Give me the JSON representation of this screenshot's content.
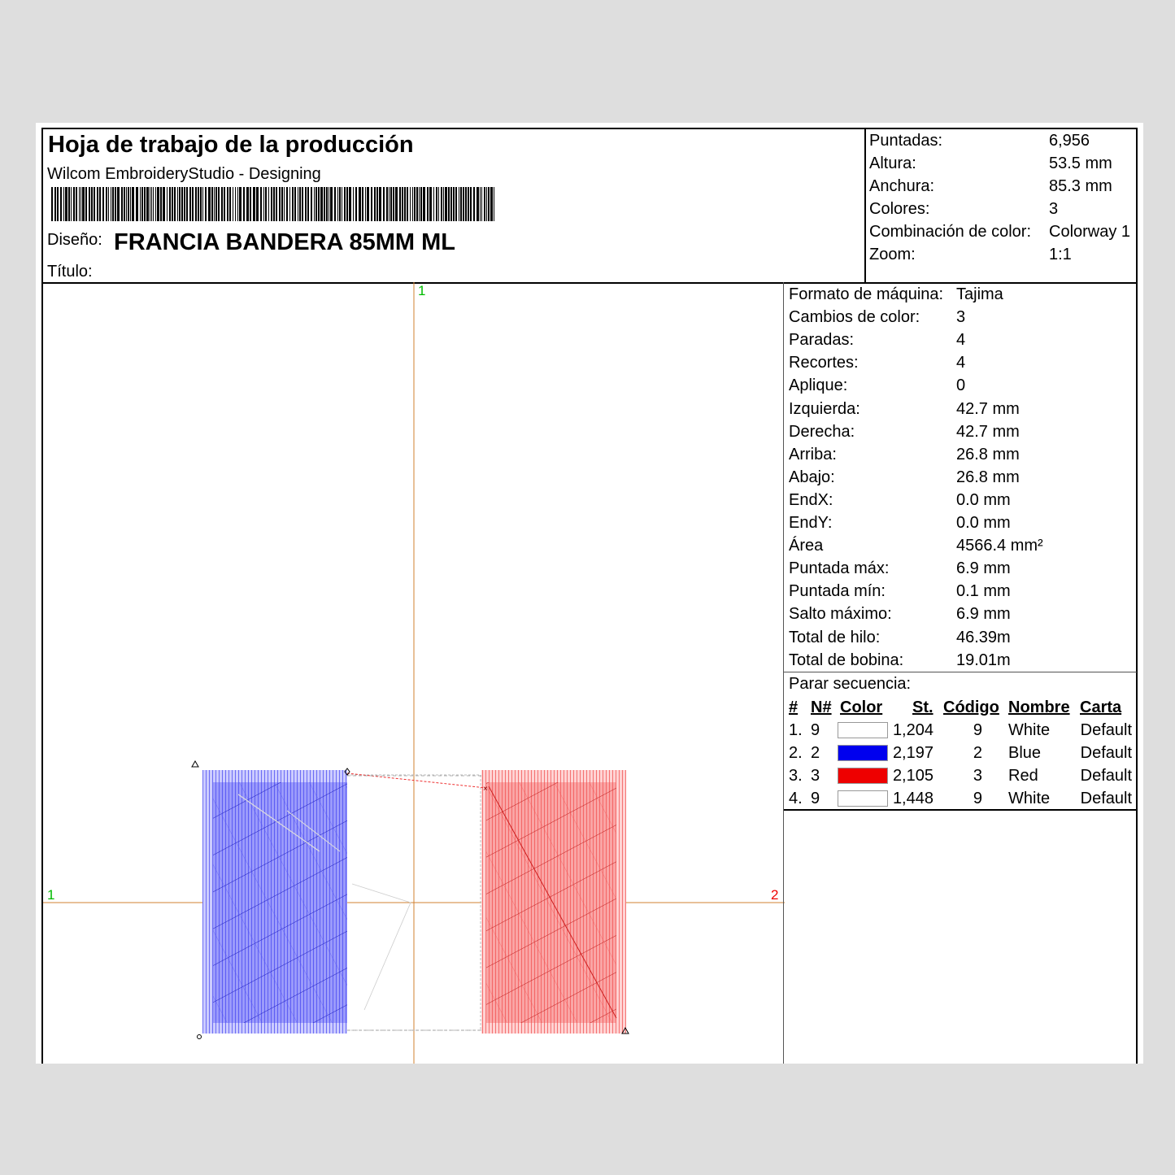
{
  "header": {
    "title": "Hoja de trabajo de la producción",
    "software": "Wilcom EmbroideryStudio - Designing",
    "design_label": "Diseño:",
    "design_value": "FRANCIA BANDERA 85MM ML",
    "title_label": "Título:"
  },
  "summary": [
    {
      "label": "Puntadas:",
      "value": "6,956"
    },
    {
      "label": "Altura:",
      "value": "53.5 mm"
    },
    {
      "label": "Anchura:",
      "value": "85.3 mm"
    },
    {
      "label": "Colores:",
      "value": "3"
    },
    {
      "label": "Combinación  de color:",
      "value": "Colorway 1"
    },
    {
      "label": "Zoom:",
      "value": "1:1"
    }
  ],
  "stats": [
    {
      "label": "Formato de máquina:",
      "value": "Tajima"
    },
    {
      "label": "Cambios de color:",
      "value": "3"
    },
    {
      "label": "Paradas:",
      "value": "4"
    },
    {
      "label": "Recortes:",
      "value": "4"
    },
    {
      "label": "Aplique:",
      "value": "0"
    },
    {
      "label": "Izquierda:",
      "value": "42.7 mm"
    },
    {
      "label": "Derecha:",
      "value": "42.7 mm"
    },
    {
      "label": "Arriba:",
      "value": "26.8 mm"
    },
    {
      "label": "Abajo:",
      "value": "26.8 mm"
    },
    {
      "label": "EndX:",
      "value": "0.0 mm"
    },
    {
      "label": "EndY:",
      "value": "0.0 mm"
    },
    {
      "label": "Área",
      "value": "4566.4 mm²"
    },
    {
      "label": "Puntada máx:",
      "value": "6.9 mm"
    },
    {
      "label": "Puntada mín:",
      "value": "0.1 mm"
    },
    {
      "label": "Salto máximo:",
      "value": "6.9 mm"
    },
    {
      "label": "Total de hilo:",
      "value": "46.39m"
    },
    {
      "label": "Total de bobina:",
      "value": "19.01m"
    }
  ],
  "sequence": {
    "label": "Parar secuencia:",
    "headers": {
      "idx": "#",
      "n": "N#",
      "color": "Color",
      "st": "St.",
      "code": "Código",
      "name": "Nombre",
      "chart": "Carta"
    },
    "rows": [
      {
        "idx": "1.",
        "n": "9",
        "swatch": "#ffffff",
        "st": "1,204",
        "code": "9",
        "name": "White",
        "chart": "Default"
      },
      {
        "idx": "2.",
        "n": "2",
        "swatch": "#0000ee",
        "st": "2,197",
        "code": "2",
        "name": "Blue",
        "chart": "Default"
      },
      {
        "idx": "3.",
        "n": "3",
        "swatch": "#ee0000",
        "st": "2,105",
        "code": "3",
        "name": "Red",
        "chart": "Default"
      },
      {
        "idx": "4.",
        "n": "9",
        "swatch": "#ffffff",
        "st": "1,448",
        "code": "9",
        "name": "White",
        "chart": "Default"
      }
    ]
  },
  "canvas": {
    "axis_labels": {
      "top": "1",
      "left": "1",
      "right": "2"
    },
    "colors": {
      "axis": "#d08030",
      "blue": "#2020ee",
      "red": "#ee2a2a",
      "green": "#00bb00",
      "redlabel": "#ee0000"
    }
  }
}
